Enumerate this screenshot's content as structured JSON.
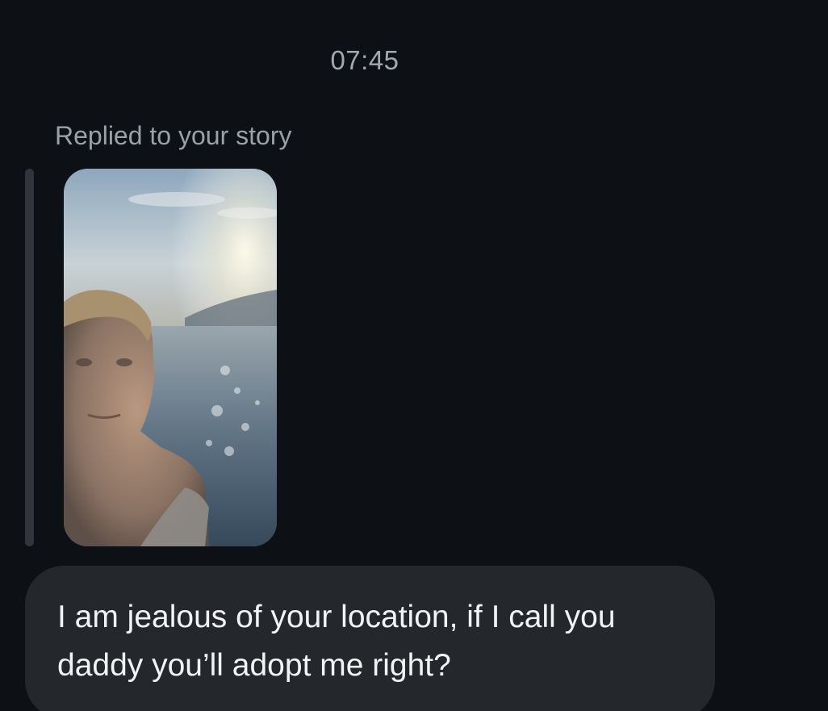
{
  "conversation": {
    "timestamp": "07:45",
    "reply_label": "Replied to your story",
    "story": {
      "thumbnail": "story-photo"
    },
    "message": {
      "text": "I am jealous of your location, if I call you daddy you’ll adopt me right?"
    }
  },
  "colors": {
    "background": "#0d1015",
    "bubble": "#24272c",
    "reply_bar": "#31353b",
    "secondary_text": "#a3a9b1",
    "message_text": "#f2f3f5"
  }
}
